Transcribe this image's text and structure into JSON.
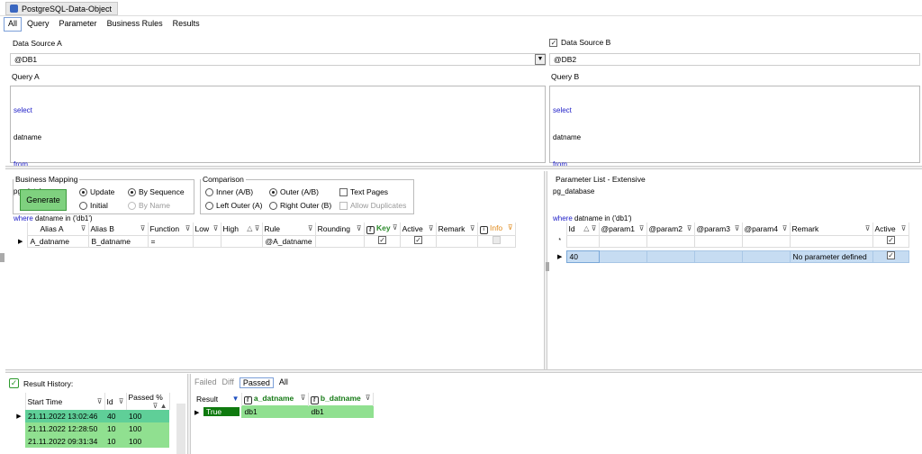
{
  "window": {
    "tab_title": "PostgreSQL-Data-Object"
  },
  "tabs": [
    "All",
    "Query",
    "Parameter",
    "Business Rules",
    "Results"
  ],
  "source_a": {
    "label": "Data Source A",
    "value": "@DB1",
    "query_label": "Query A",
    "query_lines": [
      {
        "text": "select",
        "kw": true
      },
      {
        "text": "datname",
        "kw": false
      },
      {
        "text": "from",
        "kw": true
      },
      {
        "text": "pg_database",
        "kw": false
      },
      {
        "kw_prefix": "where",
        "text": " datname in ('db1')"
      }
    ]
  },
  "source_b": {
    "label": "Data Source B",
    "value": "@DB2",
    "query_label": "Query B",
    "query_lines": [
      {
        "text": "select",
        "kw": true
      },
      {
        "text": "datname",
        "kw": false
      },
      {
        "text": "from",
        "kw": true
      },
      {
        "text": "pg_database",
        "kw": false
      },
      {
        "kw_prefix": "where",
        "text": " datname in ('db1')"
      }
    ]
  },
  "business_mapping": {
    "legend": "Business Mapping",
    "generate": "Generate",
    "update": "Update",
    "initial": "Initial",
    "by_sequence": "By Sequence",
    "by_name": "By Name"
  },
  "comparison": {
    "legend": "Comparison",
    "inner": "Inner (A/B)",
    "outer": "Outer (A/B)",
    "left_outer": "Left Outer (A)",
    "right_outer": "Right Outer (B)",
    "text_pages": "Text Pages",
    "allow_duplicates": "Allow Duplicates"
  },
  "mapping_grid": {
    "headers": [
      "Alias A",
      "Alias B",
      "Function",
      "Low",
      "High",
      "Rule",
      "Rounding",
      "Key",
      "Active",
      "Remark",
      "Info"
    ],
    "row": {
      "alias_a": "A_datname",
      "alias_b": "B_datname",
      "function": "=",
      "rule": "@A_datname"
    }
  },
  "param_list": {
    "title": "Parameter List - Extensive",
    "headers": [
      "Id",
      "@param1",
      "@param2",
      "@param3",
      "@param4",
      "Remark",
      "Active"
    ],
    "new_row_marker": "*",
    "row": {
      "id": "40",
      "remark": "No parameter defined"
    }
  },
  "history": {
    "title": "Result History:",
    "headers": [
      "Start Time",
      "Id",
      "Passed %"
    ],
    "rows": [
      {
        "time": "21.11.2022 13:02:46",
        "id": "40",
        "passed": "100"
      },
      {
        "time": "21.11.2022 12:28:50",
        "id": "10",
        "passed": "100"
      },
      {
        "time": "21.11.2022 09:31:34",
        "id": "10",
        "passed": "100"
      }
    ]
  },
  "results": {
    "tabs": [
      "Failed",
      "Diff",
      "Passed",
      "All"
    ],
    "headers": [
      "Result",
      "a_datname",
      "b_datname"
    ],
    "row": {
      "result": "True",
      "a": "db1",
      "b": "db1"
    }
  },
  "colors": {
    "accent_green": "#7fd17f",
    "row_green": "#90e090",
    "row_dark_green": "#0f7a0f",
    "selected_blue": "#c6dcf2"
  }
}
